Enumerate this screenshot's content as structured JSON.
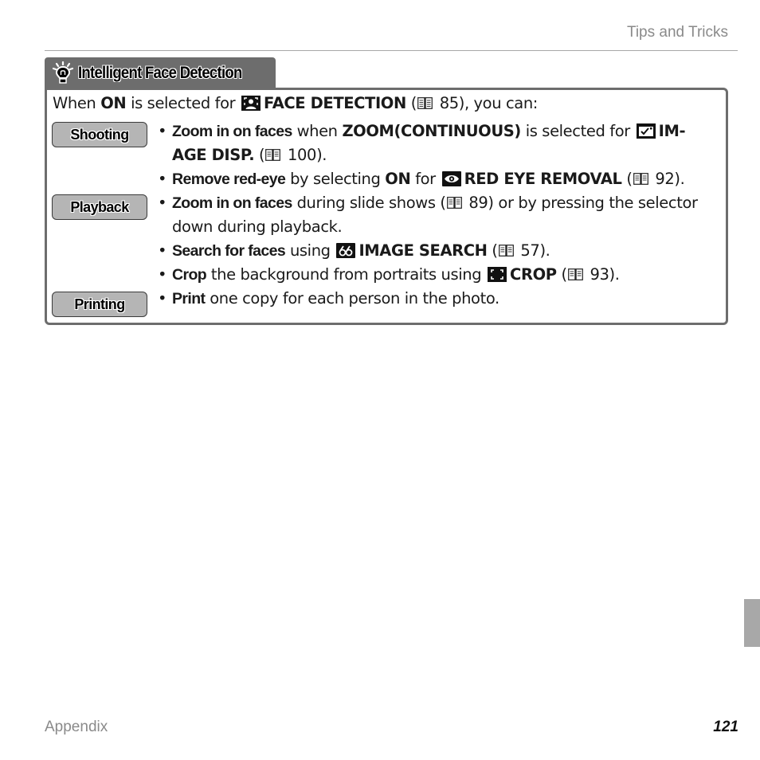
{
  "header": {
    "section": "Tips and Tricks"
  },
  "tip": {
    "icon": "lightbulb-icon",
    "title": "Intelligent Face Detection",
    "intro": {
      "prefix": "When ",
      "on": "ON",
      "middle": " is selected for ",
      "icon": "face-detection-icon",
      "setting": "FACE DETECTION",
      "ref_open": " (",
      "ref_icon": "book-icon",
      "ref_page": " 85",
      "suffix": "), you can:"
    },
    "tags": [
      {
        "label": "Shooting"
      },
      {
        "label": "Playback"
      },
      {
        "label": "Printing"
      }
    ],
    "bullets": [
      {
        "action": "Zoom in on faces",
        "t1": " when ",
        "b1": "ZOOM(CONTINUOUS)",
        "t2": " is selected for ",
        "icon": "image-display-icon",
        "setting": "IM-AGE DISP.",
        "setting_a": "IM-",
        "setting_b": "AGE DISP.",
        "ref_page": " 100",
        "end": ")."
      },
      {
        "action": "Remove red-eye",
        "t1": " by selecting ",
        "b1": "ON",
        "t2": " for ",
        "icon": "red-eye-icon",
        "setting": "RED EYE REMOVAL",
        "ref_page": " 92",
        "end": ")."
      },
      {
        "action": "Zoom in on faces",
        "t1": " during slide shows (",
        "ref_page": " 89",
        "t2": ") or by pressing the selector down during playback."
      },
      {
        "action": "Search for faces",
        "t1": " using ",
        "icon": "image-search-icon",
        "setting": "IMAGE SEARCH",
        "ref_page": " 57",
        "end": ")."
      },
      {
        "action": "Crop",
        "t1": " the background from portraits using ",
        "icon": "crop-icon",
        "setting": "CROP",
        "ref_page": " 93",
        "end": ")."
      },
      {
        "action": "Print",
        "t1": " one copy for each person in the photo."
      }
    ],
    "bullet_mark": "•",
    "ref_open": " ("
  },
  "footer": {
    "section": "Appendix",
    "page_number": "121"
  },
  "colors": {
    "tab_bg": "#6d6d6d",
    "tag_bg": "#b5b5b5",
    "muted_text": "#8a8a8a",
    "side_tab": "#a8a8a8"
  }
}
